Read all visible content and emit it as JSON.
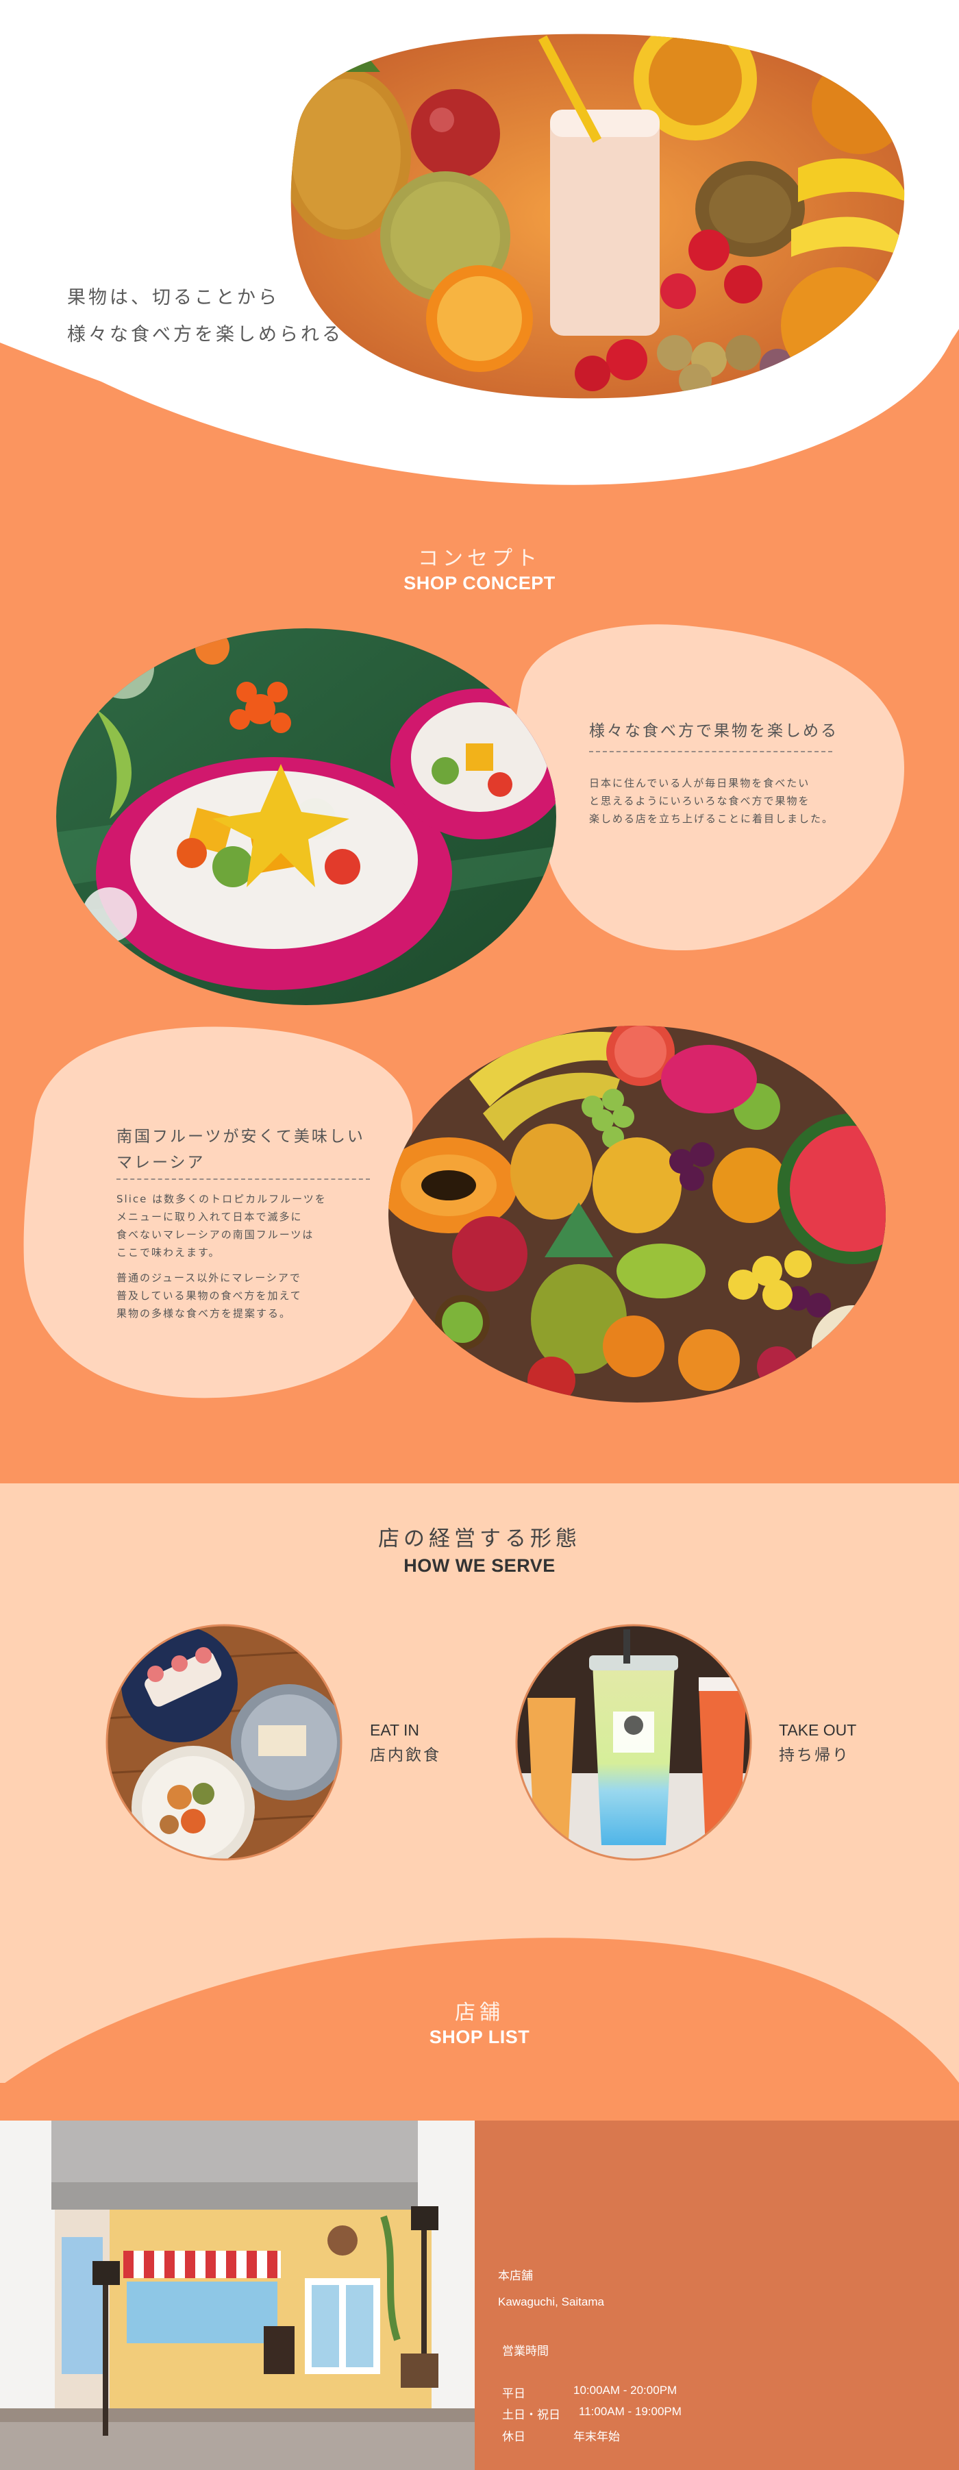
{
  "colors": {
    "orange": "#fb955f",
    "peach": "#ffd2b3",
    "peach_blob": "#ffd6bd",
    "shop_info_bg": "#d9784e",
    "white": "#ffffff"
  },
  "hero": {
    "caption_line1": "果物は、切ることから",
    "caption_line2": "様々な食べ方を楽しめられる",
    "image": "fruit-smoothie-photo"
  },
  "concept": {
    "title_jp": "コンセプト",
    "title_en": "SHOP CONCEPT",
    "block1": {
      "image": "dragon-fruit-bowl-photo",
      "heading": "様々な食べ方で果物を楽しめる",
      "body_lines": [
        "日本に住んでいる人が毎日果物を食べたい",
        "と思えるようにいろいろな食べ方で果物を",
        "楽しめる店を立ち上げることに着目しました。"
      ]
    },
    "block2": {
      "image": "tropical-fruits-photo",
      "heading_line1": "南国フルーツが安くて美味しい",
      "heading_line2": "マレーシア",
      "para1_lines": [
        "Slice は数多くのトロピカルフルーツを",
        "メニューに取り入れて日本で滅多に",
        "食べないマレーシアの南国フルーツは",
        "ここで味わえます。"
      ],
      "para2_lines": [
        "普通のジュース以外にマレーシアで",
        "普及している果物の食べ方を加えて",
        "果物の多様な食べ方を提案する。"
      ]
    }
  },
  "serve": {
    "title_jp": "店の経営する形態",
    "title_en": "HOW WE SERVE",
    "eat_in": {
      "en": "EAT IN",
      "jp": "店内飲食",
      "image": "plated-fruit-dishes-photo"
    },
    "take_out": {
      "en": "TAKE OUT",
      "jp": "持ち帰り",
      "image": "bubble-tea-cups-photo"
    }
  },
  "shop_list": {
    "title_jp": "店舗",
    "title_en": "SHOP LIST",
    "image": "storefront-illustration",
    "store_label": "本店舗",
    "location": "Kawaguchi, Saitama",
    "hours_label": "営業時間",
    "hours": [
      {
        "day": "平日",
        "time": "10:00AM - 20:00PM"
      },
      {
        "day": "土日・祝日",
        "time": "11:00AM - 19:00PM"
      },
      {
        "day": "休日",
        "time": "年末年始"
      }
    ]
  }
}
